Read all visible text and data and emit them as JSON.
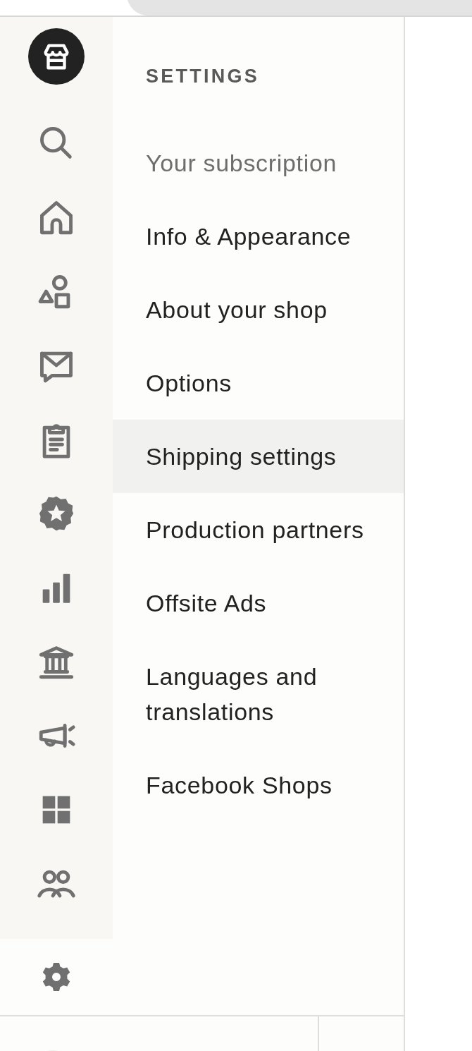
{
  "settings": {
    "heading": "SETTINGS",
    "items": [
      {
        "label": "Your subscription",
        "selected": false,
        "disabled": true
      },
      {
        "label": "Info & Appearance",
        "selected": false,
        "disabled": false
      },
      {
        "label": "About your shop",
        "selected": false,
        "disabled": false
      },
      {
        "label": "Options",
        "selected": false,
        "disabled": false
      },
      {
        "label": "Shipping settings",
        "selected": true,
        "disabled": false
      },
      {
        "label": "Production partners",
        "selected": false,
        "disabled": false
      },
      {
        "label": "Offsite Ads",
        "selected": false,
        "disabled": false
      },
      {
        "label": "Languages and translations",
        "selected": false,
        "disabled": false
      },
      {
        "label": "Facebook Shops",
        "selected": false,
        "disabled": false
      }
    ]
  }
}
